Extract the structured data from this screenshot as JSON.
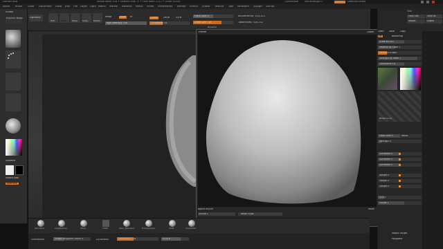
{
  "title_bar": {
    "app": "ZBrush 4R6",
    "info": "Active Mem 378  •  Scratch Disk 77  •  Free Mem 1117  •  Timer 0.003",
    "quicksave": "QuickSave",
    "seethrough": "See-through  0",
    "menus_label": "Menus",
    "script_label": "DefaultZScript"
  },
  "menu_bar": {
    "items": [
      "Alpha",
      "Brush",
      "Color",
      "Document",
      "Draw",
      "Edit",
      "File",
      "Layer",
      "Light",
      "Macro",
      "Marker",
      "Material",
      "Movie",
      "Picker",
      "Preferences",
      "Render",
      "Stencil",
      "Stroke",
      "Texture",
      "Tool",
      "Transform",
      "Zplugin",
      "Zscript"
    ]
  },
  "toolbar": {
    "xlcade": "XScale",
    "projection_master": "Projection Master",
    "lightbox": "LightBox",
    "edit": "Edit",
    "draw": "Draw",
    "move": "Move",
    "scale": "Scale",
    "rotate": "Rotate",
    "mrgb": "Mrgb",
    "rgb": "Rgb",
    "m": "M",
    "zadd": "Zadd",
    "zsub": "Zsub",
    "zcut": "Zcut",
    "rgb_intensity": "Rgb Intensity 100",
    "z_intensity": "Z Intensity 32",
    "focal_shift": "Focal Shift 0",
    "draw_size": "Draw Size 718",
    "dynamic": "Dynamic",
    "active_points": "ActivePoints: 525,212",
    "total_points": "TotalPoints: 525,212"
  },
  "left_shelf": {
    "gradient_label": "Gradient",
    "switch_color_label": "SwitchColor",
    "alternate_label": "Alternate"
  },
  "frame_dialog": {
    "title": "Frame",
    "zoom_label": "Zoom",
    "alpha_label": "Alpha On/Off",
    "xscale_field": "XScale 1",
    "reset_scale": "Reset Scale",
    "ok": "OK",
    "cancel": "CANCEL",
    "move_label": "Move"
  },
  "right_panel": {
    "tool_label": "Tool",
    "load_tool": "Load Tool",
    "save_as": "Save As",
    "import": "Import",
    "export": "Export",
    "open": "Open",
    "save": "Save",
    "copy": "Copy",
    "on": "On",
    "noise_plug": "NoisePlug",
    "scale_value": "Scale 69.293",
    "magnify": "Magnify By Scale 1",
    "strength": "Strength 0.0867",
    "strength_mask": "Strength By Mask 1",
    "color_blend": "ColorBlend 0.6",
    "noise_curve": "Noise Curve",
    "focal_shift": "Focal Shift 0",
    "offset": "Offset",
    "strength2": "Strength 0",
    "sdiv_x": "3DOffsetX 0",
    "sdiv_y": "3DOffsetY 0",
    "sdiv_z": "2DOffsetZ 0",
    "x_angle": "XAngle 0",
    "y_angle": "YAngle 0",
    "z_angle": "ZAngle 0",
    "val_a": "0.031",
    "y_scale": "YScale 1",
    "morph_target": "Morph Target",
    "polypaint": "Polypaint"
  },
  "brush_bar": {
    "brushes": [
      "Standard",
      "ClayBuildup",
      "Move",
      "Inflat",
      "hPolish",
      "Dam_Standard",
      "TrimDynamic",
      "hPolish",
      "Slide",
      "InnerOrbit"
    ]
  },
  "status_bar": {
    "zremesher": "ZRemesher",
    "target_poly": "Target Polygons Count 5",
    "dynamesh": "DynaMesh",
    "resolution": "Resolution 128",
    "subdiv": "SDiv 6"
  },
  "colors": {
    "accent": "#d87a2a",
    "frame_border": "#555555"
  }
}
